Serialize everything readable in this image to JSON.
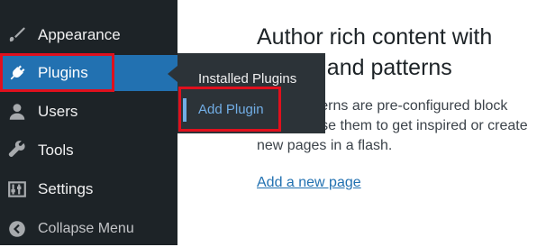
{
  "sidebar": {
    "items": [
      {
        "label": "Appearance",
        "icon": "paintbrush-icon"
      },
      {
        "label": "Plugins",
        "icon": "plug-icon",
        "active": true
      },
      {
        "label": "Users",
        "icon": "user-icon"
      },
      {
        "label": "Tools",
        "icon": "wrench-icon"
      },
      {
        "label": "Settings",
        "icon": "settings-sliders-icon"
      }
    ],
    "collapse_label": "Collapse Menu",
    "active_color": "#2271b1",
    "background_color": "#1d2327"
  },
  "submenu": {
    "items": [
      {
        "label": "Installed Plugins"
      },
      {
        "label": "Add Plugin",
        "focused": true
      }
    ],
    "background_color": "#2c3338",
    "focused_color": "#72aee6"
  },
  "main": {
    "heading": "Author rich content with blocks and patterns",
    "body": "Block patterns are pre-configured block layouts. Use them to get inspired or create new pages in a flash.",
    "link_label": "Add a new page"
  },
  "highlight_color": "#e0101d"
}
